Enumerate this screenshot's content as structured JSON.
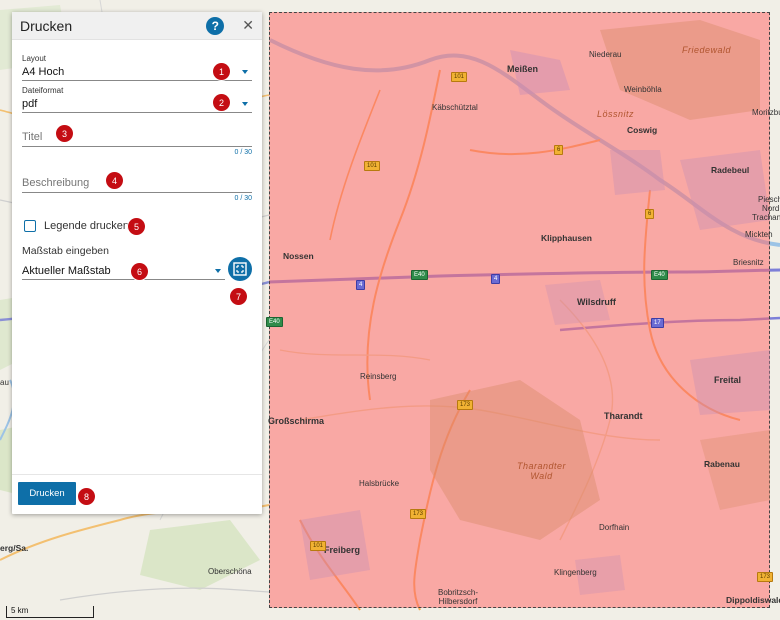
{
  "panel": {
    "title": "Drucken",
    "help_glyph": "?",
    "close_glyph": "✕",
    "layout": {
      "label": "Layout",
      "value": "A4 Hoch"
    },
    "format": {
      "label": "Dateiformat",
      "value": "pdf"
    },
    "title_field": {
      "placeholder": "Titel",
      "counter": "0 / 30"
    },
    "description_field": {
      "placeholder": "Beschreibung",
      "counter": "0 / 30"
    },
    "legend": {
      "label": "Legende drucken",
      "checked": false
    },
    "scale": {
      "heading": "Maßstab eingeben",
      "value": "Aktueller Maßstab"
    },
    "print_button": "Drucken"
  },
  "badges": [
    "1",
    "2",
    "3",
    "4",
    "5",
    "6",
    "7",
    "8"
  ],
  "map": {
    "scale_label": "5 km",
    "places": {
      "meissen": "Meißen",
      "niederau": "Niederau",
      "friedewald": "Friedewald",
      "weinboehla": "Weinböhla",
      "kaebschuetztal": "Käbschütztal",
      "loessnitz": "Lössnitz",
      "coswig": "Coswig",
      "moritzburg": "Moritzbu",
      "radebeul": "Radebeul",
      "pieschen": "Piesch",
      "nord": "Nord",
      "trachau": "Trachan",
      "mickten": "Mickten",
      "briesnitz": "Briesnitz",
      "klipphausen": "Klipphausen",
      "nossen": "Nossen",
      "wilsdruff": "Wilsdruff",
      "reinsberg": "Reinsberg",
      "tharandt": "Tharandt",
      "freital": "Freital",
      "grossschirma": "Großschirma",
      "tharandter_wald": "Tharandter\nWald",
      "rabenau": "Rabenau",
      "halsbruecke": "Halsbrücke",
      "dorfhain": "Dorfhain",
      "freiberg": "Freiberg",
      "oberschoena": "Oberschöna",
      "klingenberg": "Klingenberg",
      "bobritzsch": "Bobritzsch-\nHilbersdorf",
      "dippoldiswalde": "Dippoldiswalde",
      "freiberg_sa": "erg/Sa.",
      "edge_au": "au"
    },
    "shields": {
      "b101_a": "101",
      "b101_b": "101",
      "b101_c": "101",
      "b6_a": "6",
      "b6_b": "6",
      "a4_a": "4",
      "a4_b": "4",
      "e40_a": "E40",
      "e40_b": "E40",
      "e40_c": "E40",
      "b17": "17",
      "b173_a": "173",
      "b173_b": "173",
      "b173_c": "173"
    }
  }
}
